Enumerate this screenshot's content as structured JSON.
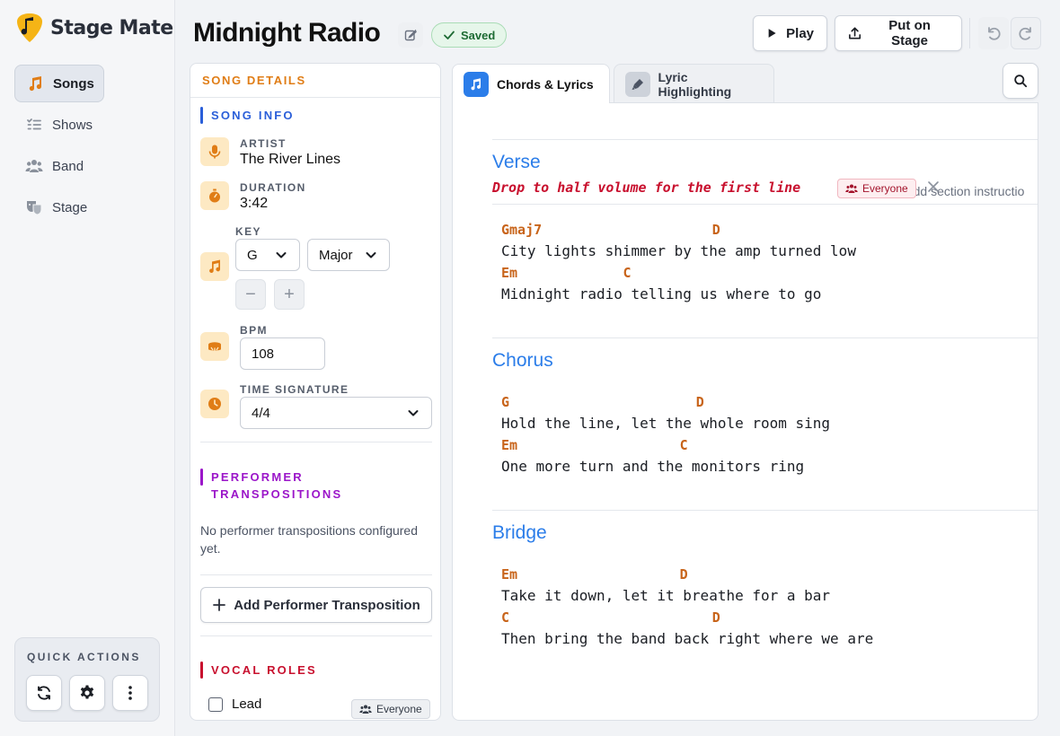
{
  "app": {
    "name": "Stage Mate"
  },
  "nav": [
    {
      "label": "Songs",
      "active": true
    },
    {
      "label": "Shows"
    },
    {
      "label": "Band"
    },
    {
      "label": "Stage"
    }
  ],
  "quick_actions": {
    "title": "QUICK ACTIONS"
  },
  "song": {
    "title": "Midnight Radio",
    "status": "Saved"
  },
  "toolbar": {
    "play_label": "Play",
    "stage_label": "Put on Stage"
  },
  "details": {
    "header": "SONG DETAILS",
    "song_info_title": "SONG INFO",
    "artist_label": "ARTIST",
    "artist": "The River Lines",
    "duration_label": "DURATION",
    "duration": "3:42",
    "key_label": "KEY",
    "key": "G",
    "mode": "Major",
    "step_down": "−",
    "step_up": "+",
    "bpm_label": "BPM",
    "bpm": "108",
    "time_sig_label": "TIME SIGNATURE",
    "time_sig": "4/4",
    "transpositions_title_1": "PERFORMER",
    "transpositions_title_2": "TRANSPOSITIONS",
    "transpositions_note": "No performer transpositions configured yet.",
    "add_transposition": "Add Performer Transposition",
    "vocal_roles_title": "VOCAL ROLES",
    "vocal_role": "Lead",
    "vocal_role_tag": "Everyone"
  },
  "tabs": {
    "chords": "Chords & Lyrics",
    "highlight": "Lyric Highlighting"
  },
  "sections": {
    "verse": {
      "name": "Verse",
      "instruction": "Drop to half volume for the first line",
      "tag": "Everyone",
      "add_instruction": "+ Add section instructio",
      "lines": [
        {
          "chords": "Gmaj7                     D",
          "lyric": "City lights shimmer by the amp turned low"
        },
        {
          "chords": "Em             C",
          "lyric": "Midnight radio telling us where to go"
        }
      ]
    },
    "chorus": {
      "name": "Chorus",
      "lines": [
        {
          "chords": "G                       D",
          "lyric": "Hold the line, let the whole room sing"
        },
        {
          "chords": "Em                    C",
          "lyric": "One more turn and the monitors ring"
        }
      ]
    },
    "bridge": {
      "name": "Bridge",
      "lines": [
        {
          "chords": "Em                    D",
          "lyric": "Take it down, let it breathe for a bar"
        },
        {
          "chords": "C                         D",
          "lyric": "Then bring the band back right where we are"
        }
      ]
    }
  },
  "colors": {
    "accent_orange": "#e07d16",
    "accent_blue": "#2b7de9",
    "accent_red": "#c8102e",
    "chord": "#c8641a",
    "purple": "#9b16c9"
  }
}
